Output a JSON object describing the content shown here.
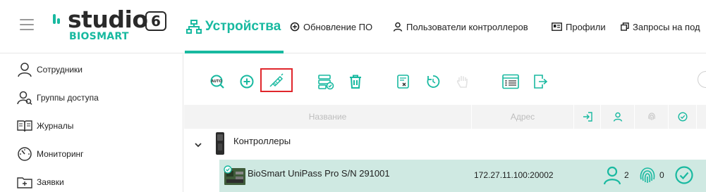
{
  "header": {
    "logo_word": "studio",
    "logo_number": "6",
    "logo_sub": "BIOSMART",
    "nav": [
      {
        "label": "Устройства",
        "icon": "network-icon",
        "active": true
      },
      {
        "label": "Обновление ПО",
        "icon": "update-icon",
        "active": false
      },
      {
        "label": "Пользователи контроллеров",
        "icon": "user-icon",
        "active": false
      },
      {
        "label": "Профили",
        "icon": "id-card-icon",
        "active": false
      },
      {
        "label": "Запросы на под",
        "icon": "copy-icon",
        "active": false
      }
    ]
  },
  "sidebar": {
    "items": [
      {
        "label": "Сотрудники",
        "icon": "person-icon"
      },
      {
        "label": "Группы доступа",
        "icon": "group-icon"
      },
      {
        "label": "Журналы",
        "icon": "book-icon"
      },
      {
        "label": "Мониторинг",
        "icon": "gauge-icon"
      },
      {
        "label": "Заявки",
        "icon": "folder-plus-icon"
      }
    ]
  },
  "toolbar": {
    "buttons": [
      {
        "name": "auto-search-icon"
      },
      {
        "name": "add-icon"
      },
      {
        "name": "usb-connect-icon",
        "highlighted": true
      },
      {
        "name": "settings-check-icon"
      },
      {
        "name": "delete-icon"
      },
      {
        "name": "report-icon"
      },
      {
        "name": "sync-icon"
      },
      {
        "name": "hand-icon",
        "disabled": true
      },
      {
        "name": "list-view-icon"
      },
      {
        "name": "export-icon"
      }
    ]
  },
  "table": {
    "columns": {
      "name": "Название",
      "address": "Адрес",
      "enter_icon": "login-icon",
      "users_icon": "user-icon",
      "fingerprint_icon": "fingerprint-icon",
      "status_icon": "check-circle-icon"
    },
    "group": {
      "label": "Контроллеры",
      "expanded": true
    },
    "device": {
      "name": "BioSmart UniPass Pro S/N 291001",
      "address": "172.27.11.100:20002",
      "users": "2",
      "fingerprints": "0",
      "status": "ok"
    }
  },
  "colors": {
    "accent": "#18b9a0",
    "selected_row": "#cfe9e2",
    "highlight": "#e0262c",
    "header_bg": "#f3f3f3"
  }
}
